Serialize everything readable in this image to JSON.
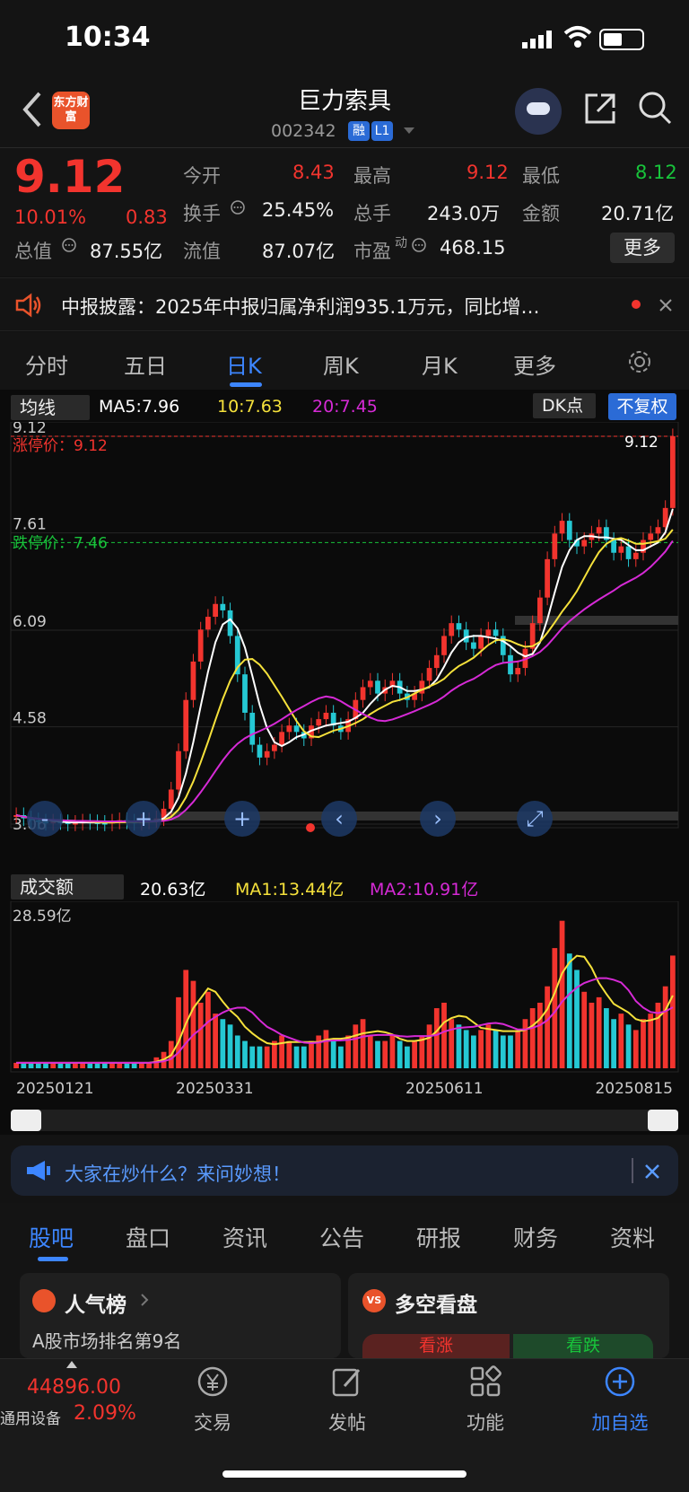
{
  "status": {
    "time": "10:34"
  },
  "header": {
    "logo": "东方财富",
    "name": "巨力索具",
    "code": "002342",
    "tag1": "融",
    "tag2": "L1"
  },
  "quote": {
    "price": "9.12",
    "pct": "10.01%",
    "chg": "0.83",
    "r1": [
      {
        "l": "今开",
        "v": "8.43"
      },
      {
        "l": "最高",
        "v": "9.12"
      },
      {
        "l": "最低",
        "v": "8.12"
      }
    ],
    "r2": [
      {
        "l": "换手",
        "v": "25.45%"
      },
      {
        "l": "总手",
        "v": "243.0万"
      },
      {
        "l": "金额",
        "v": "20.71亿"
      }
    ],
    "r3": [
      {
        "l": "总值",
        "v": "87.55亿"
      },
      {
        "l": "流值",
        "v": "87.07亿"
      },
      {
        "l": "市盈",
        "sup": "动",
        "v": "468.15"
      }
    ],
    "more": "更多"
  },
  "notice": "中报披露：2025年中报归属净利润935.1万元，同比增…",
  "tabs": [
    "分时",
    "五日",
    "日K",
    "周K",
    "月K",
    "更多"
  ],
  "chart_data": [
    {
      "type": "line",
      "title": "日K",
      "indicator": "均线",
      "ma5": "MA5:7.96",
      "ma10": "10:7.63",
      "ma20": "20:7.45",
      "dk": "DK点",
      "fq": "不复权",
      "y_ticks": [
        "9.12",
        "7.61",
        "6.09",
        "4.58",
        "3.06"
      ],
      "limit_up": "涨停价：9.12",
      "limit_down": "跌停价：7.46",
      "last": "9.12",
      "ylim": [
        3.06,
        9.12
      ],
      "close": [
        3.2,
        3.15,
        3.12,
        3.1,
        3.08,
        3.1,
        3.09,
        3.07,
        3.08,
        3.1,
        3.09,
        3.08,
        3.07,
        3.1,
        3.12,
        3.1,
        3.08,
        3.1,
        3.12,
        3.15,
        3.3,
        3.6,
        4.2,
        5.0,
        5.6,
        6.1,
        6.3,
        6.5,
        6.4,
        6.0,
        5.4,
        4.8,
        4.3,
        4.1,
        4.2,
        4.3,
        4.5,
        4.6,
        4.5,
        4.4,
        4.6,
        4.7,
        4.8,
        4.6,
        4.5,
        4.7,
        5.0,
        5.2,
        5.3,
        5.1,
        5.2,
        5.3,
        5.1,
        5.0,
        5.1,
        5.3,
        5.5,
        5.7,
        6.0,
        6.2,
        6.1,
        5.9,
        5.8,
        6.0,
        6.1,
        6.0,
        5.7,
        5.4,
        5.5,
        5.8,
        6.2,
        6.6,
        7.2,
        7.6,
        7.8,
        7.5,
        7.4,
        7.5,
        7.6,
        7.7,
        7.5,
        7.3,
        7.4,
        7.2,
        7.3,
        7.5,
        7.6,
        7.7,
        8.0,
        9.12
      ],
      "colors": {
        "up": "#f2342e",
        "down": "#25c8d3",
        "ma5": "#ffffff",
        "ma10": "#f5e13b",
        "ma20": "#d62ad6"
      }
    },
    {
      "type": "bar",
      "title": "成交额",
      "value": "20.63亿",
      "ma1": "MA1:13.44亿",
      "ma2": "MA2:10.91亿",
      "ymax_label": "28.59亿",
      "x_ticks": [
        "20250121",
        "20250331",
        "20250611",
        "20250815"
      ],
      "values": [
        1,
        1,
        1,
        1,
        1,
        1,
        1,
        1,
        1,
        1,
        1,
        1,
        1,
        1,
        1,
        1,
        1,
        1,
        1,
        2,
        3,
        5,
        13,
        18,
        16,
        12,
        14,
        10,
        9,
        8,
        6,
        5,
        4,
        4,
        4,
        5,
        6,
        5,
        4,
        4,
        5,
        6,
        7,
        5,
        4,
        6,
        8,
        9,
        6,
        5,
        5,
        6,
        5,
        4,
        5,
        6,
        8,
        11,
        12,
        9,
        8,
        7,
        6,
        7,
        8,
        7,
        6,
        6,
        7,
        9,
        11,
        12,
        15,
        22,
        27,
        21,
        18,
        14,
        12,
        13,
        11,
        9,
        10,
        8,
        7,
        9,
        10,
        12,
        15,
        20.63
      ]
    }
  ],
  "ask": "大家在炒什么？来问妙想！",
  "tabs2": [
    "股吧",
    "盘口",
    "资讯",
    "公告",
    "研报",
    "财务",
    "资料"
  ],
  "cards": {
    "c1_title": "人气榜",
    "c1_sub": "A股市场排名第9名",
    "c2_title": "多空看盘",
    "c2_up": "看涨",
    "c2_down": "看跌"
  },
  "bottom": {
    "index": "44896.00",
    "sector": "通用设备",
    "sector_pct": "2.09%",
    "items": [
      "交易",
      "发帖",
      "功能",
      "加自选"
    ]
  }
}
